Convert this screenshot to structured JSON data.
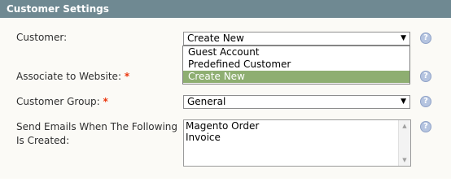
{
  "header": {
    "title": "Customer Settings"
  },
  "fields": {
    "customer": {
      "label": "Customer:",
      "value": "Create New"
    },
    "website": {
      "label": "Associate to Website:",
      "required": "*"
    },
    "group": {
      "label": "Customer Group:",
      "required": "*",
      "value": "General"
    },
    "emails": {
      "label_line1": "Send Emails When The Following",
      "label_line2": "Is Created:",
      "options": [
        "Magento Order",
        "Invoice"
      ]
    }
  },
  "dropdown": {
    "options": [
      "Guest Account",
      "Predefined Customer",
      "Create New"
    ],
    "selected": "Create New"
  },
  "icons": {
    "help": "?",
    "select_arrow": "▼",
    "scroll_up": "▲",
    "scroll_down": "▼"
  },
  "colors": {
    "header_bg": "#6f8992",
    "panel_bg": "#fbfaf6",
    "selected_option_bg": "#8eae71",
    "required": "#eb340a"
  }
}
